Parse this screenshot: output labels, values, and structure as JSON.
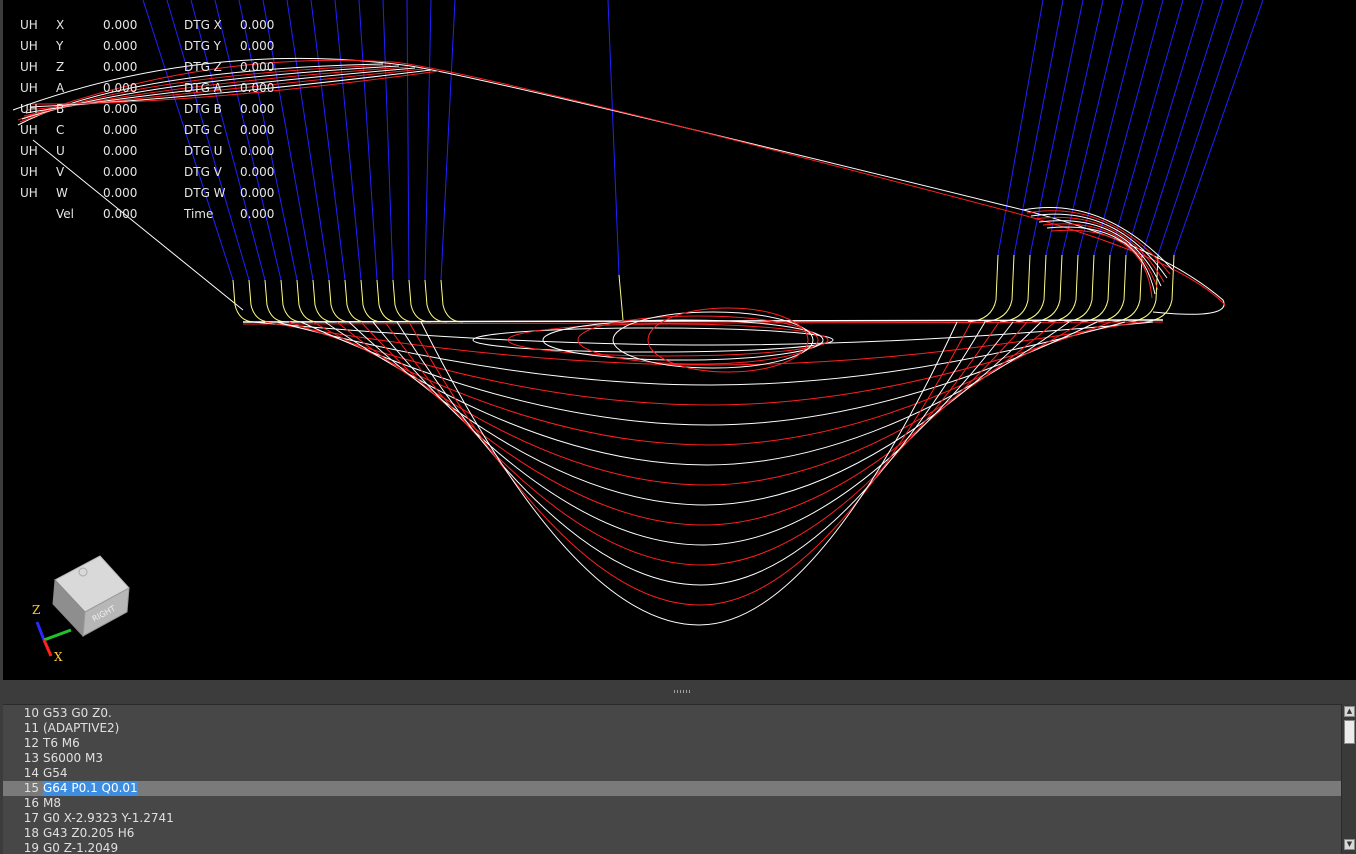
{
  "dro": [
    {
      "label": "UH",
      "axis": "X",
      "value": "0.000",
      "dtg_label": "DTG X",
      "dtg_value": "0.000"
    },
    {
      "label": "UH",
      "axis": "Y",
      "value": "0.000",
      "dtg_label": "DTG Y",
      "dtg_value": "0.000"
    },
    {
      "label": "UH",
      "axis": "Z",
      "value": "0.000",
      "dtg_label": "DTG Z",
      "dtg_value": "0.000"
    },
    {
      "label": "UH",
      "axis": "A",
      "value": "0.000",
      "dtg_label": "DTG A",
      "dtg_value": "0.000"
    },
    {
      "label": "UH",
      "axis": "B",
      "value": "0.000",
      "dtg_label": "DTG B",
      "dtg_value": "0.000"
    },
    {
      "label": "UH",
      "axis": "C",
      "value": "0.000",
      "dtg_label": "DTG C",
      "dtg_value": "0.000"
    },
    {
      "label": "UH",
      "axis": "U",
      "value": "0.000",
      "dtg_label": "DTG U",
      "dtg_value": "0.000"
    },
    {
      "label": "UH",
      "axis": "V",
      "value": "0.000",
      "dtg_label": "DTG V",
      "dtg_value": "0.000"
    },
    {
      "label": "UH",
      "axis": "W",
      "value": "0.000",
      "dtg_label": "DTG W",
      "dtg_value": "0.000"
    },
    {
      "label": "",
      "axis": "Vel",
      "value": "0.000",
      "dtg_label": "Time",
      "dtg_value": "0.000"
    }
  ],
  "viewcube": {
    "face_label": "RIGHT",
    "axis_z": "Z",
    "axis_x": "X"
  },
  "colors": {
    "rapid": "#2020ff",
    "feed": "#ffffff",
    "arc": "#ff2020",
    "transition": "#ffff80",
    "background": "#000000"
  },
  "gcode": {
    "current_line_number": 15,
    "lines": [
      {
        "n": "10",
        "text": "G53 G0 Z0."
      },
      {
        "n": "11",
        "text": "(ADAPTIVE2)"
      },
      {
        "n": "12",
        "text": "T6 M6"
      },
      {
        "n": "13",
        "text": "S6000 M3"
      },
      {
        "n": "14",
        "text": "G54"
      },
      {
        "n": "15",
        "text": "G64 P0.1 Q0.01"
      },
      {
        "n": "16",
        "text": "M8"
      },
      {
        "n": "17",
        "text": "G0 X-2.9323 Y-1.2741"
      },
      {
        "n": "18",
        "text": "G43 Z0.205 H6"
      },
      {
        "n": "19",
        "text": "G0 Z-1.2049"
      }
    ]
  }
}
